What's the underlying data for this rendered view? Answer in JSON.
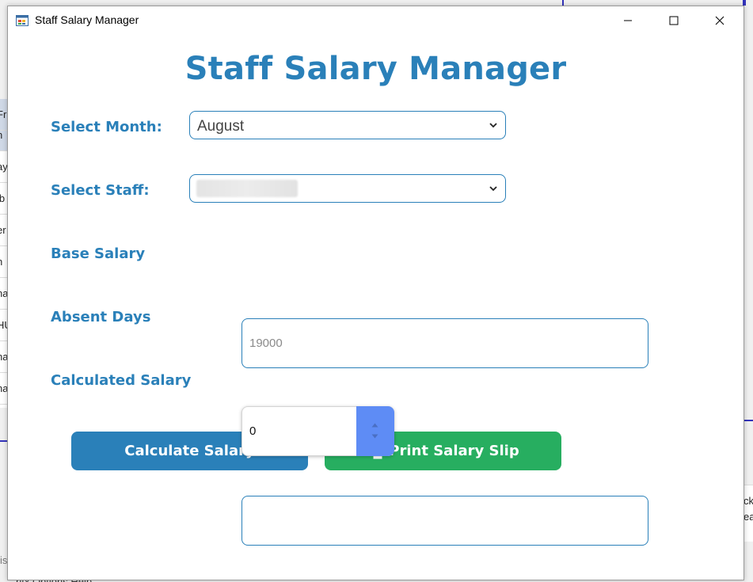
{
  "window": {
    "title": "Staff Salary Manager",
    "icon": "app-form-icon",
    "controls": [
      "minimize-icon",
      "maximize-icon",
      "close-icon"
    ]
  },
  "heading": "Staff Salary Manager",
  "form": {
    "month_label": "Select Month:",
    "month_value": "August",
    "staff_label": "Select Staff:",
    "staff_value": "",
    "base_salary_label": "Base Salary",
    "base_salary_placeholder": "19000",
    "absent_days_label": "Absent Days",
    "absent_days_value": "0",
    "calculated_salary_label": "Calculated Salary",
    "calculated_salary_value": ""
  },
  "buttons": {
    "calculate": "Calculate Salary",
    "print": "Print Salary Slip",
    "print_icon": "printer-icon"
  },
  "background": {
    "left_rows": [
      "Fr",
      "n",
      "ay",
      "lb",
      "er",
      "n",
      "na",
      "HU",
      "na",
      "na"
    ],
    "bottom_text": "is",
    "menu_text": "ritx   Options   Help",
    "right_rows": [
      "ck",
      "ea"
    ]
  },
  "colors": {
    "accent": "#2a80b9",
    "print_button": "#27ae60",
    "spinner": "#5e8cf5"
  }
}
